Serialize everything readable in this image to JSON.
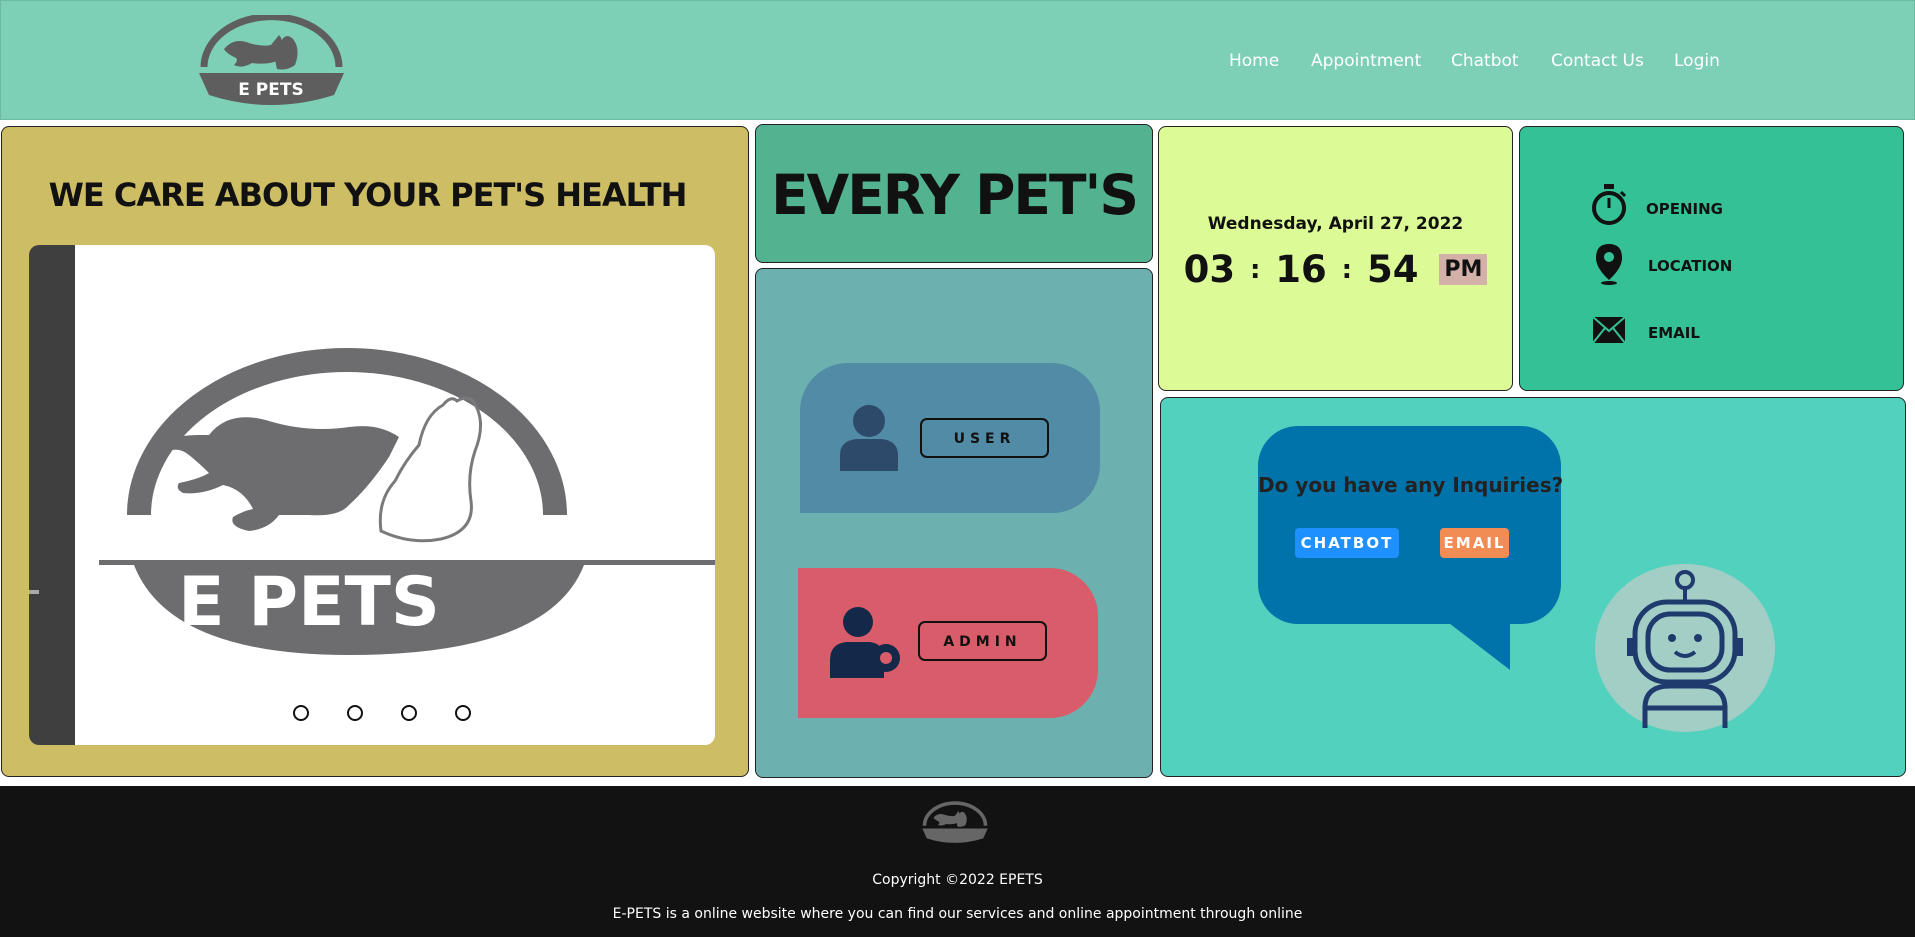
{
  "header": {
    "logo_text": "E PETS",
    "nav": [
      "Home",
      "Appointment",
      "Chatbot",
      "Contact Us",
      "Login"
    ]
  },
  "hero": {
    "title": "WE CARE ABOUT YOUR PET'S HEALTH",
    "slide_logo_text": "E PETS",
    "slide_dots": 4
  },
  "every": {
    "title": "EVERY PET'S"
  },
  "roles": {
    "user_label": "USER",
    "admin_label": "ADMIN"
  },
  "clock": {
    "date": "Wednesday, April 27, 2022",
    "hours": "03",
    "minutes": "16",
    "seconds": "54",
    "ampm": "PM",
    "sep": ":"
  },
  "info": {
    "opening": "OPENING",
    "location": "LOCATION",
    "email": "EMAIL"
  },
  "inquiry": {
    "question": "Do you have any Inquiries?",
    "chatbot_label": "CHATBOT",
    "email_label": "EMAIL"
  },
  "footer": {
    "copyright": "Copyright ©2022 EPETS",
    "description": "E-PETS is a online website where you can find our services and online appointment through online"
  },
  "colors": {
    "header_bg": "#7dcfb5",
    "care_bg": "#cdbd65",
    "every_bg": "#53b391",
    "roles_bg": "#6cb1b0",
    "user_card": "#528ba6",
    "admin_card": "#d85c69",
    "clock_bg": "#dcfa96",
    "info_bg": "#34c195",
    "chat_bg": "#53d1bf",
    "bubble": "#0073aa",
    "chatbot_btn": "#1e90ff",
    "email_btn": "#f28c55",
    "footer_bg": "#121212"
  }
}
